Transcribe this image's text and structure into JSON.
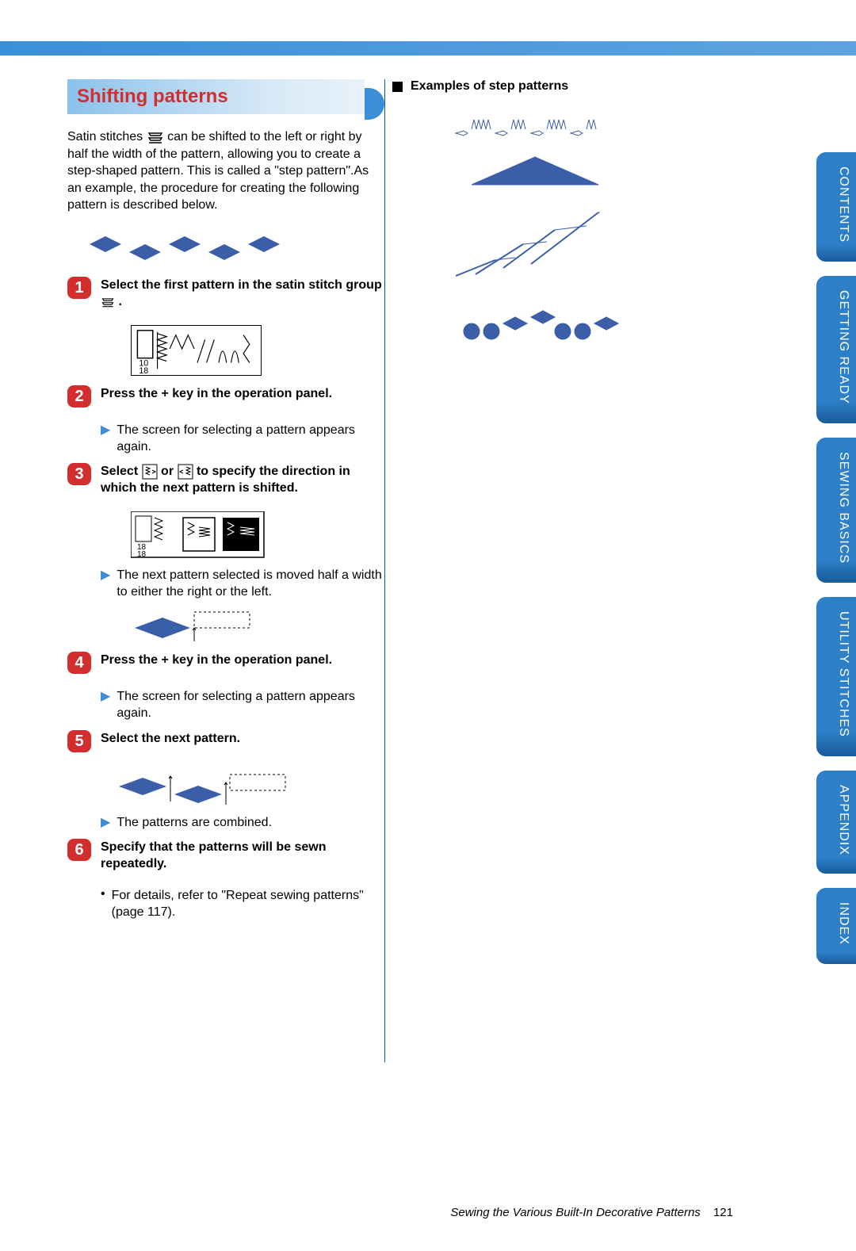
{
  "header": {
    "title": "Shifting patterns"
  },
  "intro": {
    "a": "Satin stitches ",
    "b": " can be shifted to the left or right by half the width of the pattern, allowing you to create a step-shaped pattern. This is called a \"step pattern\".As an example, the procedure for creating the following pattern is described below."
  },
  "steps": [
    {
      "num": "1",
      "text_a": "Select the first pattern in the satin stitch group ",
      "text_b": "."
    },
    {
      "num": "2",
      "text": "Press the + key in the operation panel.",
      "result": "The screen for selecting a pattern appears again."
    },
    {
      "num": "3",
      "text_a": "Select ",
      "text_b": " or ",
      "text_c": " to specify the direction in which the next pattern is shifted.",
      "result": "The next pattern selected is moved half a width to either the right or the left."
    },
    {
      "num": "4",
      "text": "Press the + key in the operation panel.",
      "result": "The screen for selecting a pattern appears again."
    },
    {
      "num": "5",
      "text": "Select the next pattern.",
      "result": "The patterns are combined."
    },
    {
      "num": "6",
      "text": "Specify that the patterns will be sewn repeatedly.",
      "bullet": "For details, refer to \"Repeat sewing patterns\" (page 117)."
    }
  ],
  "right": {
    "title": "Examples of step patterns"
  },
  "tabs": [
    "CONTENTS",
    "GETTING READY",
    "SEWING BASICS",
    "UTILITY STITCHES",
    "APPENDIX",
    "INDEX"
  ],
  "footer": {
    "section": "Sewing the Various Built-In Decorative Patterns",
    "page": "121"
  }
}
